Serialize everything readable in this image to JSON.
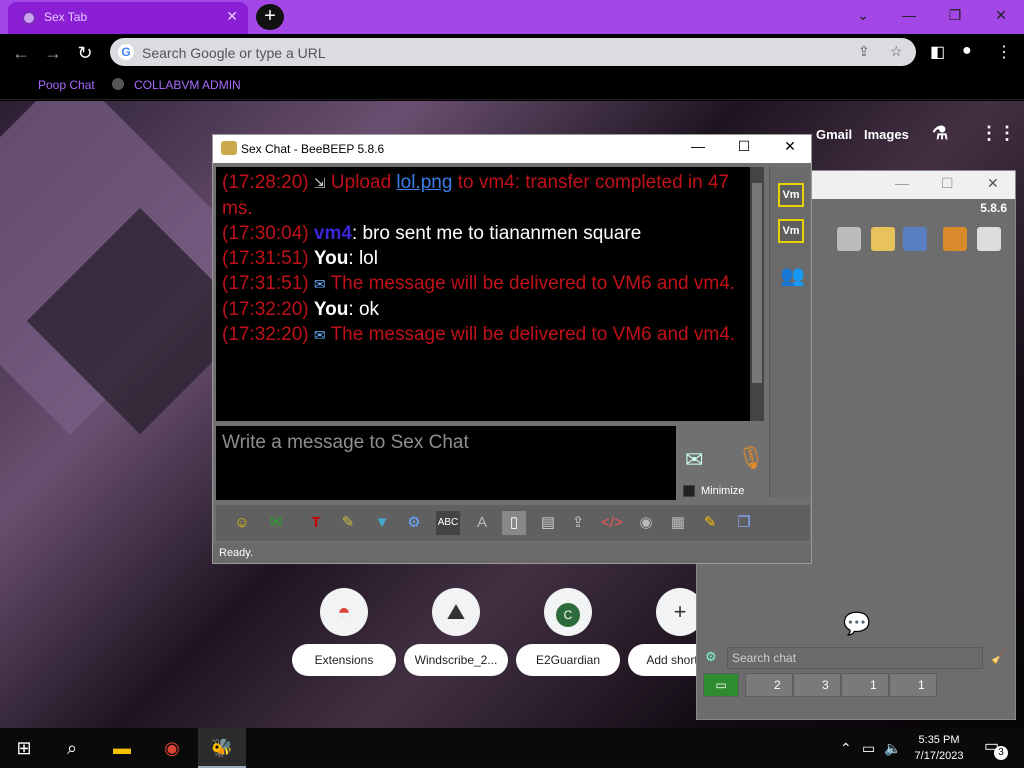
{
  "browser": {
    "tab_title": "Sex Tab",
    "omnibox_placeholder": "Search Google or type a URL",
    "bookmarks": [
      "Poop Chat",
      "COLLABVM ADMIN"
    ]
  },
  "google": {
    "gmail": "Gmail",
    "images": "Images"
  },
  "shortcuts": [
    {
      "label": "Extensions",
      "icon": "extensions-icon"
    },
    {
      "label": "Windscribe_2...",
      "icon": "windscribe-icon"
    },
    {
      "label": "E2Guardian",
      "icon_letter": "C",
      "icon": "e2guardian-icon"
    },
    {
      "label": "Add shortcut",
      "icon": "plus-icon"
    }
  ],
  "beebeep_front": {
    "title": "Sex Chat - BeeBEEP 5.8.6",
    "messages": {
      "m1_time": "(17:28:20)",
      "m1_pre": "Upload",
      "m1_link": "lol.png",
      "m1_post": "to vm4: transfer completed in 47 ms.",
      "m2_time": "(17:30:04)",
      "m2_user": "vm4",
      "m2_text": ": bro sent me to tiananmen square",
      "m3_time": "(17:31:51)",
      "m3_user": "You",
      "m3_text": ": lol",
      "m4_time": "(17:31:51)",
      "m4_text": "The message will be delivered to VM6 and vm4.",
      "m5_time": "(17:32:20)",
      "m5_user": "You",
      "m5_text": ": ok",
      "m6_time": "(17:32:20)",
      "m6_text": "The message will be delivered to VM6 and vm4."
    },
    "input_placeholder": "Write a message to Sex Chat",
    "minimize_label": "Minimize",
    "status": "Ready.",
    "vm_badges": [
      "Vm",
      "Vm"
    ]
  },
  "beebeep_back": {
    "version": "5.8.6",
    "search_placeholder": "Search chat",
    "tab_counts": [
      "2",
      "3",
      "1",
      "1"
    ]
  },
  "taskbar": {
    "time": "5:35 PM",
    "date": "7/17/2023",
    "notifications": "3"
  }
}
